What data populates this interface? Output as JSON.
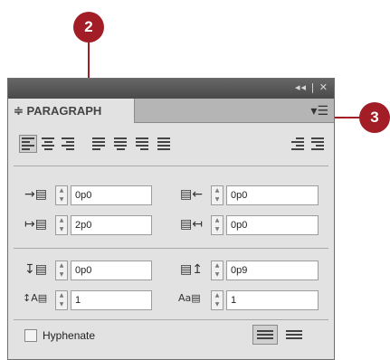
{
  "callouts": {
    "c2": "2",
    "c3": "3"
  },
  "panel": {
    "title_icons": "◂◂ | ✕",
    "tab_label": "≑ PARAGRAPH",
    "menu_icon": "▾☰"
  },
  "fields": {
    "left_indent": "0p0",
    "right_indent": "0p0",
    "first_line_indent": "2p0",
    "last_line_right_indent": "0p0",
    "space_before": "0p0",
    "space_after": "0p9",
    "drop_cap_lines": "1",
    "drop_cap_chars": "1"
  },
  "hyphenate_label": "Hyphenate",
  "colors": {
    "callout": "#a21d26",
    "panel_bg": "#e2e2e2",
    "titlebar": "#555555"
  }
}
